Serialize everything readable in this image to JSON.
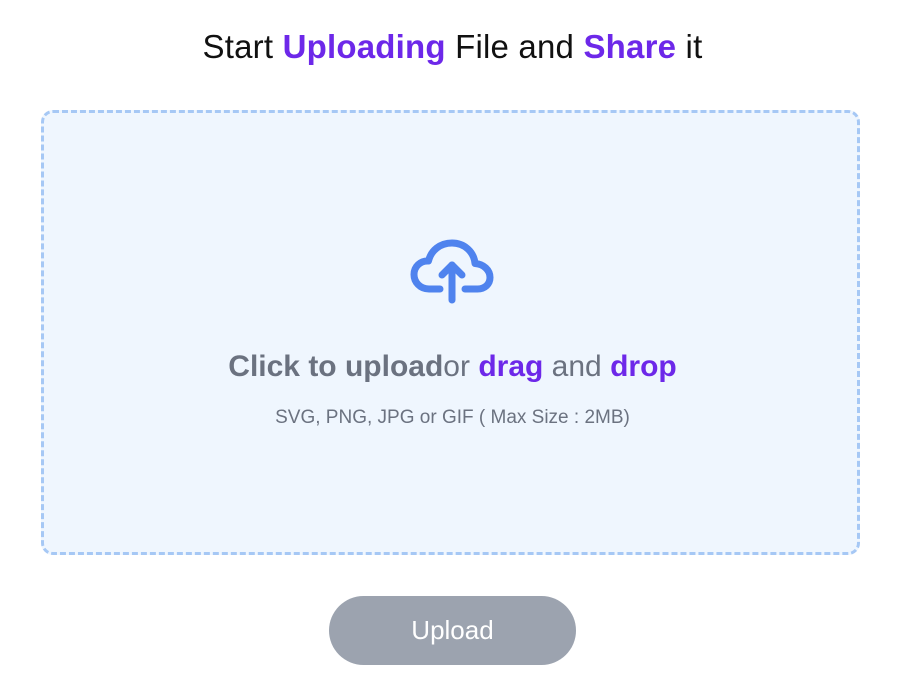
{
  "heading": {
    "part1": "Start ",
    "accent1": "Uploading",
    "part2": " File and ",
    "accent2": "Share",
    "part3": " it"
  },
  "dropzone": {
    "icon": "cloud-upload-icon",
    "click_text": "Click to upload",
    "or_text": "or ",
    "drag_text": "drag",
    "and_text": " and ",
    "drop_text": "drop",
    "hint": "SVG, PNG, JPG or GIF ( Max Size : 2MB)"
  },
  "upload_button": {
    "label": "Upload"
  },
  "colors": {
    "accent": "#6d28e9",
    "icon": "#4f83ee",
    "dropzone_bg": "#eff6fe",
    "dropzone_border": "#a6c8f5",
    "button_bg": "#9ca3af",
    "muted_text": "#6b7280"
  }
}
